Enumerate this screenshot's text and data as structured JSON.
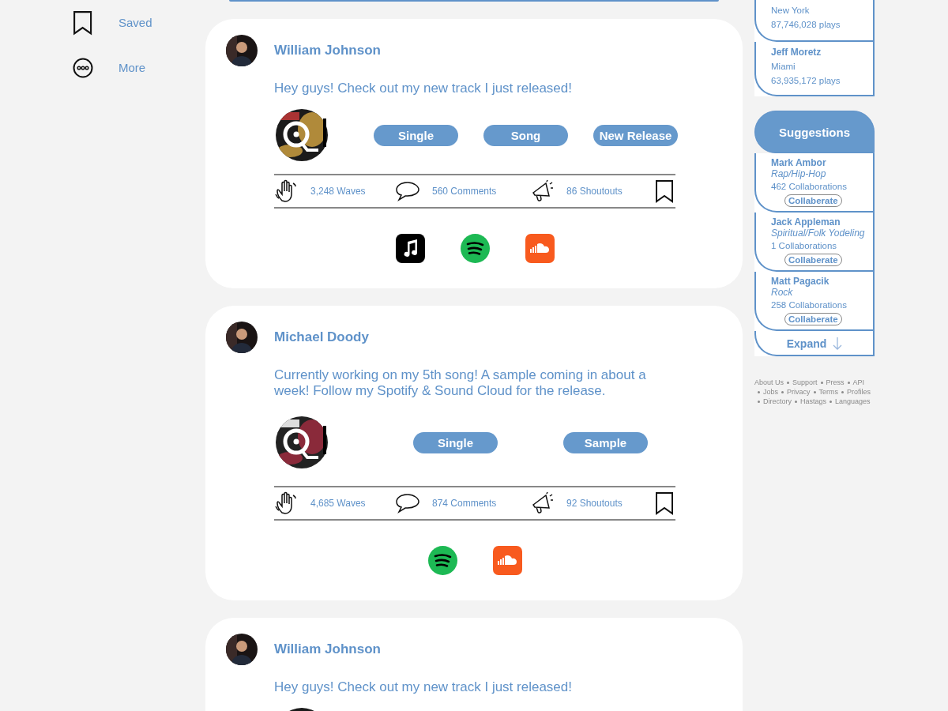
{
  "sidebar": {
    "items": [
      {
        "kind": "saved",
        "label": "Saved"
      },
      {
        "kind": "more",
        "label": "More"
      }
    ]
  },
  "posts": [
    {
      "author": "William Johnson",
      "text": "Hey guys! Check out my new track I just released!",
      "tags": [
        "Single",
        "Song",
        "New Release"
      ],
      "stats": {
        "waves": "3,248 Waves",
        "comments": "560 Comments",
        "shoutouts": "86 Shoutouts"
      },
      "services": [
        {
          "kind": "apple-music"
        },
        {
          "kind": "spotify"
        },
        {
          "kind": "soundcloud"
        }
      ]
    },
    {
      "author": "Michael Doody",
      "text": "Currently working on my 5th song! A sample coming in about a week! Follow my Spotify & Sound Cloud for the release.",
      "tags": [
        "Single",
        "Sample"
      ],
      "stats": {
        "waves": "4,685 Waves",
        "comments": "874 Comments",
        "shoutouts": "92 Shoutouts"
      },
      "services": [
        {
          "kind": "spotify"
        },
        {
          "kind": "soundcloud"
        }
      ]
    },
    {
      "author": "William Johnson",
      "text": "Hey guys! Check out my new track I just released!"
    }
  ],
  "top_artists": [
    {
      "location": "New York",
      "plays": "87,746,028 plays"
    },
    {
      "name": "Jeff Moretz",
      "location": "Miami",
      "plays": "63,935,172 plays"
    }
  ],
  "suggestions": {
    "title": "Suggestions",
    "items": [
      {
        "name": "Mark Ambor",
        "genre": "Rap/Hip-Hop",
        "collaborations": "462 Collaborations",
        "button": "Collaberate"
      },
      {
        "name": "Jack Appleman",
        "genre": "Spiritual/Folk Yodeling",
        "collaborations": "1 Collaborations",
        "button": "Collaberate"
      },
      {
        "name": "Matt Pagacik",
        "genre": "Rock",
        "collaborations": "258 Collaborations",
        "button": "Collaberate"
      }
    ],
    "expand": "Expand"
  },
  "footer_links": [
    "About Us",
    "Support",
    "Press",
    "API",
    "Jobs",
    "Privacy",
    "Terms",
    "Profiles",
    "Directory",
    "Hastags",
    "Languages"
  ]
}
